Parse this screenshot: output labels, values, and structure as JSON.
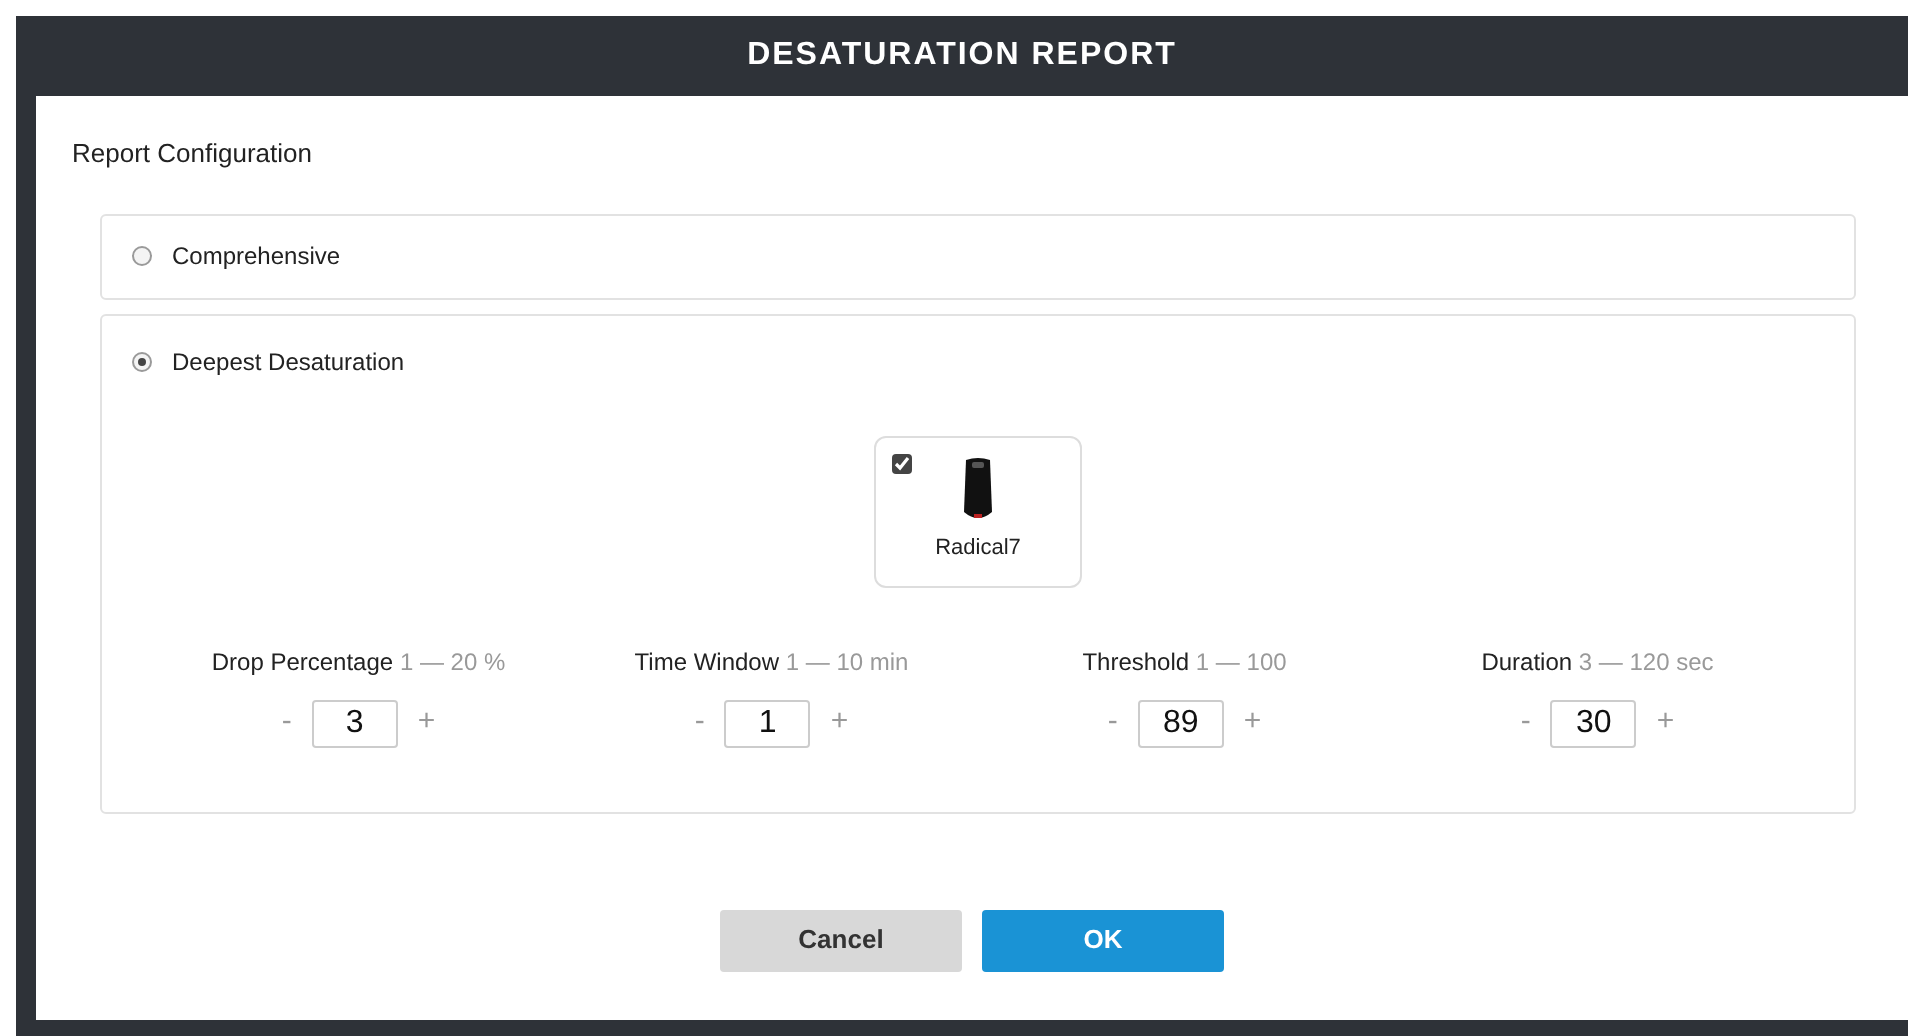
{
  "window": {
    "title": "DESATURATION REPORT"
  },
  "section_title": "Report Configuration",
  "options": [
    {
      "label": "Comprehensive",
      "selected": false
    },
    {
      "label": "Deepest Desaturation",
      "selected": true
    }
  ],
  "device": {
    "name": "Radical7",
    "checked": true
  },
  "parameters": [
    {
      "label": "Drop Percentage",
      "range": "1 — 20 %",
      "value": "3",
      "minus": "-",
      "plus": "+"
    },
    {
      "label": "Time Window",
      "range": "1 — 10 min",
      "value": "1",
      "minus": "-",
      "plus": "+"
    },
    {
      "label": "Threshold",
      "range": "1 — 100",
      "value": "89",
      "minus": "-",
      "plus": "+"
    },
    {
      "label": "Duration",
      "range": "3 — 120 sec",
      "value": "30",
      "minus": "-",
      "plus": "+"
    }
  ],
  "buttons": [
    {
      "label": "Cancel",
      "kind": "secondary"
    },
    {
      "label": "OK",
      "kind": "primary"
    }
  ]
}
